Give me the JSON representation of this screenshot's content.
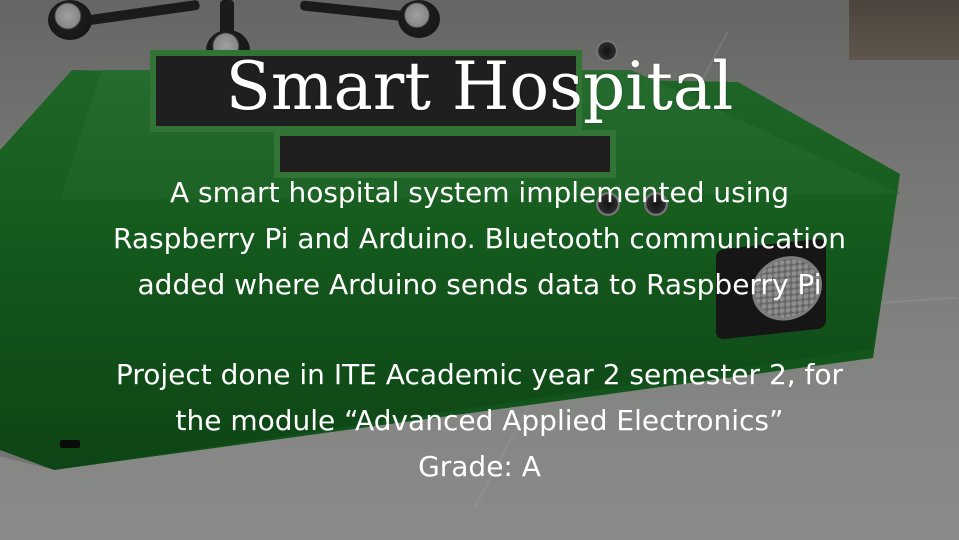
{
  "slide": {
    "title": "Smart Hospital",
    "description_lines": [
      "A smart hospital system implemented using",
      "Raspberry Pi and Arduino. Bluetooth communication",
      "added where Arduino sends data to Raspberry Pi"
    ],
    "project_lines": [
      "Project done in ITE Academic year 2 semester 2, for",
      "the module “Advanced Applied Electronics”",
      "Grade: A"
    ]
  },
  "colors": {
    "text": "#ffffff",
    "box_green": "#1f8a2d",
    "overlay": "rgba(0,0,0,0.34)"
  }
}
